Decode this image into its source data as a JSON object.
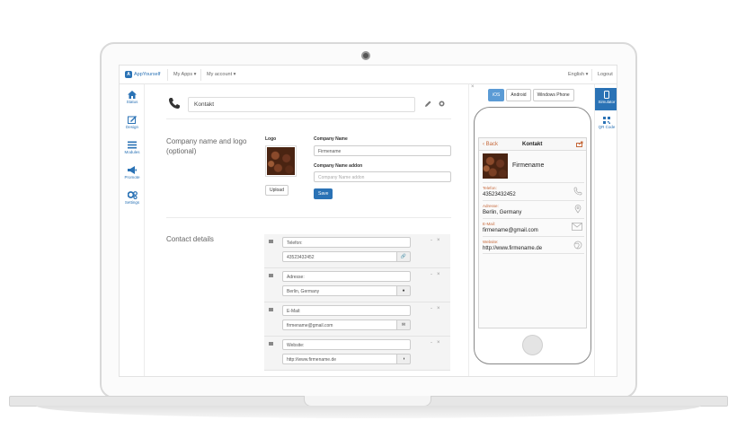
{
  "topbar": {
    "brand": "AppYourself",
    "my_apps": "My Apps ▾",
    "my_account": "My account ▾",
    "language": "English ▾",
    "logout": "Logout"
  },
  "sidebar": {
    "items": [
      {
        "label": "Status",
        "icon": "home-icon"
      },
      {
        "label": "Design",
        "icon": "design-icon"
      },
      {
        "label": "Modules",
        "icon": "modules-icon"
      },
      {
        "label": "Promote",
        "icon": "megaphone-icon"
      },
      {
        "label": "Settings",
        "icon": "gears-icon"
      }
    ]
  },
  "module": {
    "title": "Kontakt"
  },
  "company_section": {
    "title_line1": "Company name and logo",
    "title_line2": "(optional)",
    "logo_label": "Logo",
    "upload_button": "Upload",
    "company_name_label": "Company Name",
    "company_name_value": "Firmename",
    "company_addon_label": "Company Name addon",
    "company_addon_placeholder": "Company Name addon",
    "save_button": "Save"
  },
  "contact_section": {
    "title": "Contact details",
    "items": [
      {
        "label": "Telefon:",
        "value": "43523432452",
        "icon": "link-icon"
      },
      {
        "label": "Adresse:",
        "value": "Berlin, Germany",
        "icon": "map-pin-icon"
      },
      {
        "label": "E-Mail:",
        "value": "firmename@gmail.com",
        "icon": "envelope-icon"
      },
      {
        "label": "Website:",
        "value": "http://www.firmename.de",
        "icon": "globe-icon"
      }
    ],
    "row_minus": "-",
    "row_close": "×"
  },
  "simulator": {
    "close": "×",
    "os_tabs": [
      "iOS",
      "Android",
      "Windows Phone"
    ],
    "active_os": "iOS",
    "phone": {
      "back": "‹ Back",
      "title": "Kontakt",
      "company": "Firmename",
      "rows": [
        {
          "label": "Telefon:",
          "value": "43523432452"
        },
        {
          "label": "Adresse:",
          "value": "Berlin, Germany"
        },
        {
          "label": "E-Mail:",
          "value": "firmename@gmail.com"
        },
        {
          "label": "Website:",
          "value": "http://www.firmename.de"
        }
      ]
    }
  },
  "right_tabs": {
    "simulator": "Simulator",
    "qr_code": "QR Code"
  },
  "colors": {
    "accent": "#2a72b5",
    "phone_label": "#c6683a"
  }
}
